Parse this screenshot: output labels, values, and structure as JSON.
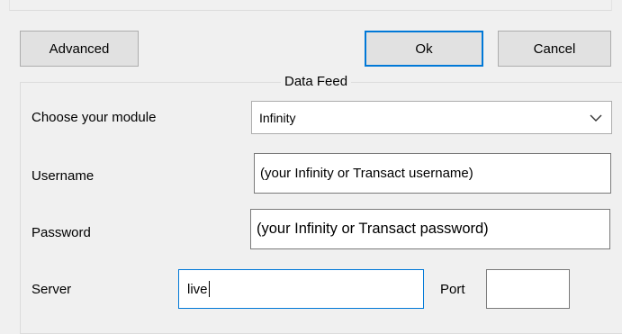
{
  "buttons": {
    "advanced": "Advanced",
    "ok": "Ok",
    "cancel": "Cancel"
  },
  "group": {
    "legend": "Data Feed"
  },
  "module": {
    "label": "Choose your module",
    "value": "Infinity"
  },
  "username": {
    "label": "Username",
    "value": "(your Infinity or Transact username)"
  },
  "password": {
    "label": "Password",
    "value": "(your Infinity or Transact password)"
  },
  "server": {
    "label": "Server",
    "value": "live"
  },
  "port": {
    "label": "Port",
    "value": ""
  },
  "colors": {
    "focus": "#0078d7",
    "button_bg": "#e1e1e1",
    "window_bg": "#f0f0f0"
  },
  "icons": {
    "combo_arrow": "chevron-down-icon"
  }
}
